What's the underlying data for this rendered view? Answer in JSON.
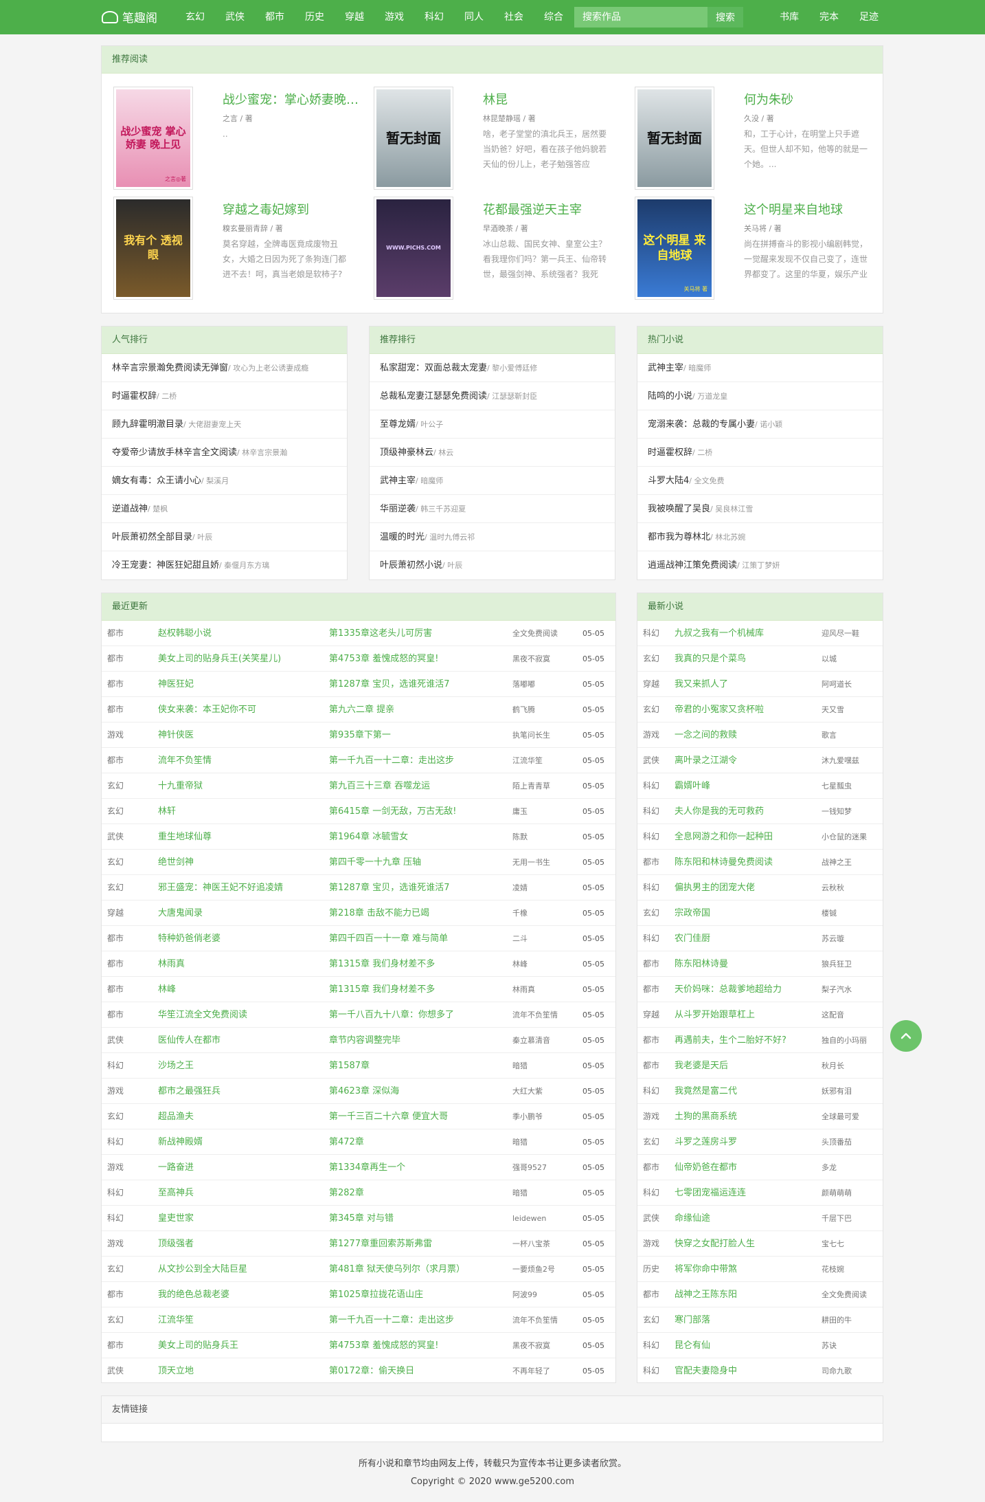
{
  "header": {
    "logo": "笔趣阁",
    "nav": [
      "玄幻",
      "武侠",
      "都市",
      "历史",
      "穿越",
      "游戏",
      "科幻",
      "同人",
      "社会",
      "综合"
    ],
    "search_placeholder": "搜索作品",
    "search_button": "搜索",
    "right_nav": [
      "书库",
      "完本",
      "足迹"
    ]
  },
  "recommend": {
    "title": "推荐阅读",
    "books": [
      {
        "title": "战少蜜宠：掌心娇妻晚上见",
        "author": "之言 / 著",
        "desc": "..",
        "cover_text": "战少蜜宠 掌心娇妻 晚上见",
        "cover_sub": "之言◎著"
      },
      {
        "title": "林昆",
        "author": "林昆楚静瑶 / 著",
        "desc": "啥，老子堂堂的滇北兵王，居然要当奶爸？好吧，看在孩子他妈貌若天仙的份儿上，老子勉强答应",
        "cover_text": "暂无封面"
      },
      {
        "title": "何为朱砂",
        "author": "久没 / 著",
        "desc": "和，工于心计，在明堂上只手遮天。但世人却不知，他等的就是一个她。...",
        "cover_text": "暂无封面"
      },
      {
        "title": "穿越之毒妃嫁到",
        "author": "糗玄曼丽青辞 / 著",
        "desc": "莫名穿越，全牌毒医竟成废物丑女，大婚之日因为死了条狗连门都进不去！呵，真当老娘是软柿子?",
        "cover_text": "我有个 透视眼"
      },
      {
        "title": "花都最强逆天主宰",
        "author": "早酒晚茶 / 著",
        "desc": "冰山总裁、国民女神、皇室公主？看我理你们吗？第一兵王、仙帝转世，最强剑神、系统强者？我死",
        "cover_text": "WWW.PICHS.COM"
      },
      {
        "title": "这个明星来自地球",
        "author": "关马将 / 著",
        "desc": "尚在拼搏奋斗的影视小编剧韩觉，一觉醒来发现不仅自己变了，连世界都变了。这里的华夏，娱乐产业",
        "cover_text": "这个明星 来自地球",
        "cover_sub": "关马将 著"
      }
    ]
  },
  "rank_popular": {
    "title": "人气排行",
    "items": [
      {
        "name": "林辛言宗景瀚免费阅读无弹窗",
        "author": "/ 攻心为上老公诱妻成瘾"
      },
      {
        "name": "时逼霍权辞",
        "author": "/ 二桥"
      },
      {
        "name": "顾九辞霍明澈目录",
        "author": "/ 大佬甜妻宠上天"
      },
      {
        "name": "夺爱帝少请放手林辛言全文阅读",
        "author": "/ 林辛言宗景瀚"
      },
      {
        "name": "嫡女有毒：众王请小心",
        "author": "/ 梨溪月"
      },
      {
        "name": "逆道战神",
        "author": "/ 楚枫"
      },
      {
        "name": "叶辰萧初然全部目录",
        "author": "/ 叶辰"
      },
      {
        "name": "冷王宠妻：神医狂妃甜且娇",
        "author": "/ 秦偃月东方璃"
      }
    ]
  },
  "rank_recommend": {
    "title": "推荐排行",
    "items": [
      {
        "name": "私家甜宠：双面总裁太宠妻",
        "author": "/ 黎小爱傅廷修"
      },
      {
        "name": "总裁私宠妻江瑟瑟免费阅读",
        "author": "/ 江瑟瑟靳封臣"
      },
      {
        "name": "至尊龙婿",
        "author": "/ 叶公子"
      },
      {
        "name": "顶级神豪林云",
        "author": "/ 林云"
      },
      {
        "name": "武神主宰",
        "author": "/ 暗魔师"
      },
      {
        "name": "华丽逆袭",
        "author": "/ 韩三千苏迎夏"
      },
      {
        "name": "温暖的时光",
        "author": "/ 温时九傅云祁"
      },
      {
        "name": "叶辰萧初然小说",
        "author": "/ 叶辰"
      }
    ]
  },
  "rank_hot": {
    "title": "热门小说",
    "items": [
      {
        "name": "武神主宰",
        "author": "/ 暗魔师"
      },
      {
        "name": "陆鸣的小说",
        "author": "/ 万道龙皇"
      },
      {
        "name": "宠溺来袭：总裁的专属小妻",
        "author": "/ 诺小颖"
      },
      {
        "name": "时逼霍权辞",
        "author": "/ 二桥"
      },
      {
        "name": "斗罗大陆4",
        "author": "/ 全文免费"
      },
      {
        "name": "我被唤醒了吴良",
        "author": "/ 吴良林江雪"
      },
      {
        "name": "都市我为尊林北",
        "author": "/ 林北苏婉"
      },
      {
        "name": "逍遥战神江策免费阅读",
        "author": "/ 江策丁梦妍"
      }
    ]
  },
  "latest": {
    "title": "最近更新",
    "rows": [
      [
        "都市",
        "赵权韩聪小说",
        "第1335章这老头儿可厉害",
        "全文免费阅读",
        "05-05"
      ],
      [
        "都市",
        "美女上司的贴身兵王(关笑星儿)",
        "第4753章 羞愧成怒的冥皇!",
        "黑夜不寂寞",
        "05-05"
      ],
      [
        "都市",
        "神医狂妃",
        "第1287章 宝贝，选谁死谁活7",
        "落嘟嘟",
        "05-05"
      ],
      [
        "都市",
        "侠女来袭：本王妃你不可",
        "第九六二章 提亲",
        "鹤飞腾",
        "05-05"
      ],
      [
        "游戏",
        "神针侠医",
        "第935章下第一",
        "执笔问长生",
        "05-05"
      ],
      [
        "都市",
        "流年不负笙情",
        "第一千九百一十二章：走出这步",
        "江流华笙",
        "05-05"
      ],
      [
        "玄幻",
        "十九重帝狱",
        "第九百三十三章 吞噬龙运",
        "陌上青青草",
        "05-05"
      ],
      [
        "玄幻",
        "林轩",
        "第6415章 一剑无敌，万古无敌!",
        "庸玉",
        "05-05"
      ],
      [
        "武侠",
        "重生地球仙尊",
        "第1964章 冰毓雪女",
        "陈默",
        "05-05"
      ],
      [
        "玄幻",
        "绝世剑神",
        "第四千零一十九章 压轴",
        "无用一书生",
        "05-05"
      ],
      [
        "玄幻",
        "邪王盛宠：神医王妃不好追凌婧",
        "第1287章 宝贝，选谁死谁活7",
        "凌婧",
        "05-05"
      ],
      [
        "穿越",
        "大唐鬼闻录",
        "第218章 击敌不能力已竭",
        "千橡",
        "05-05"
      ],
      [
        "都市",
        "特种奶爸俏老婆",
        "第四千四百一十一章 难与简单",
        "二斗",
        "05-05"
      ],
      [
        "都市",
        "林雨真",
        "第1315章 我们身材差不多",
        "林峰",
        "05-05"
      ],
      [
        "都市",
        "林峰",
        "第1315章 我们身材差不多",
        "林雨真",
        "05-05"
      ],
      [
        "都市",
        "华笙江流全文免费阅读",
        "第一千八百九十八章：你想多了",
        "流年不负笙情",
        "05-05"
      ],
      [
        "武侠",
        "医仙传人在都市",
        "章节内容调整完毕",
        "秦立慕清音",
        "05-05"
      ],
      [
        "科幻",
        "沙场之王",
        "第1587章",
        "暗猎",
        "05-05"
      ],
      [
        "游戏",
        "都市之最强狂兵",
        "第4623章 深似海",
        "大红大紫",
        "05-05"
      ],
      [
        "玄幻",
        "超品渔夫",
        "第一千三百二十六章 便宜大哥",
        "季小鹏爷",
        "05-05"
      ],
      [
        "科幻",
        "新战神殿婿",
        "第472章",
        "暗猎",
        "05-05"
      ],
      [
        "游戏",
        "一路奋进",
        "第1334章再生一个",
        "强哥9527",
        "05-05"
      ],
      [
        "科幻",
        "至高神兵",
        "第282章",
        "暗猎",
        "05-05"
      ],
      [
        "科幻",
        "皇吏世家",
        "第345章 对与错",
        "leidewen",
        "05-05"
      ],
      [
        "游戏",
        "顶级强者",
        "第1277章重回索苏斯弗雷",
        "一杯八宝茶",
        "05-05"
      ],
      [
        "玄幻",
        "从文抄公到全大陆巨星",
        "第481章 狱天使乌列尔（求月票）",
        "一要烦鱼2号",
        "05-05"
      ],
      [
        "都市",
        "我的绝色总裁老婆",
        "第1025章拉拢花语山庄",
        "阿波99",
        "05-05"
      ],
      [
        "玄幻",
        "江流华笙",
        "第一千九百一十二章：走出这步",
        "流年不负笙情",
        "05-05"
      ],
      [
        "都市",
        "美女上司的贴身兵王",
        "第4753章 羞愧成怒的冥皇!",
        "黑夜不寂寞",
        "05-05"
      ],
      [
        "武侠",
        "顶天立地",
        "第0172章：偷天换日",
        "不再年轻了",
        "05-05"
      ]
    ]
  },
  "newest": {
    "title": "最新小说",
    "rows": [
      [
        "科幻",
        "九叔之我有一个机械库",
        "迎风尽一鞋"
      ],
      [
        "玄幻",
        "我真的只是个菜鸟",
        "以城"
      ],
      [
        "穿越",
        "我又来抓人了",
        "阿呵道长"
      ],
      [
        "玄幻",
        "帝君的小冤家又贪杯啦",
        "天又雪"
      ],
      [
        "游戏",
        "一念之间的救赎",
        "歌言"
      ],
      [
        "武侠",
        "离叶录之江湖令",
        "沐九爱嘿兹"
      ],
      [
        "科幻",
        "霸婿叶峰",
        "七星瓢虫"
      ],
      [
        "科幻",
        "夫人你是我的无可救药",
        "一钱知梦"
      ],
      [
        "科幻",
        "全息网游之和你一起种田",
        "小仓鼠的迷果"
      ],
      [
        "都市",
        "陈东阳和林诗曼免费阅读",
        "战神之王"
      ],
      [
        "科幻",
        "偏执男主的团宠大佬",
        "云秋秋"
      ],
      [
        "玄幻",
        "宗政帝国",
        "楼铖"
      ],
      [
        "科幻",
        "农门佳厨",
        "苏云璇"
      ],
      [
        "都市",
        "陈东阳林诗曼",
        "狼兵狂卫"
      ],
      [
        "都市",
        "天价妈咪：总裁爹地超给力",
        "梨子汽水"
      ],
      [
        "穿越",
        "从斗罗开始跟草杠上",
        "这配音"
      ],
      [
        "都市",
        "再遇前夫，生个二胎好不好?",
        "独自的小玛丽"
      ],
      [
        "都市",
        "我老婆是天后",
        "秋月长"
      ],
      [
        "科幻",
        "我竟然是富二代",
        "妖邪有泪"
      ],
      [
        "游戏",
        "土狗的黑商系统",
        "全球最可爱"
      ],
      [
        "玄幻",
        "斗罗之莲房斗罗",
        "头顶番茄"
      ],
      [
        "都市",
        "仙帝奶爸在都市",
        "多龙"
      ],
      [
        "科幻",
        "七零团宠福运连连",
        "颜萌萌萌"
      ],
      [
        "武侠",
        "命缘仙途",
        "千层下巴"
      ],
      [
        "游戏",
        "快穿之女配打脸人生",
        "宝七七"
      ],
      [
        "历史",
        "将军你命中带煞",
        "花枝婉"
      ],
      [
        "都市",
        "战神之王陈东阳",
        "全文免费阅读"
      ],
      [
        "玄幻",
        "寒门部落",
        "耕田的牛"
      ],
      [
        "科幻",
        "昆仑有仙",
        "苏诀"
      ],
      [
        "科幻",
        "官配夫妻隐身中",
        "司命九歌"
      ]
    ]
  },
  "links": {
    "title": "友情链接"
  },
  "footer": {
    "line1": "所有小说和章节均由网友上传，转载只为宣传本书让更多读者欣赏。",
    "line2": "Copyright © 2020 www.ge5200.com"
  },
  "colors": {
    "brand": "#4daf4a",
    "panel_head": "#dff0d8"
  }
}
